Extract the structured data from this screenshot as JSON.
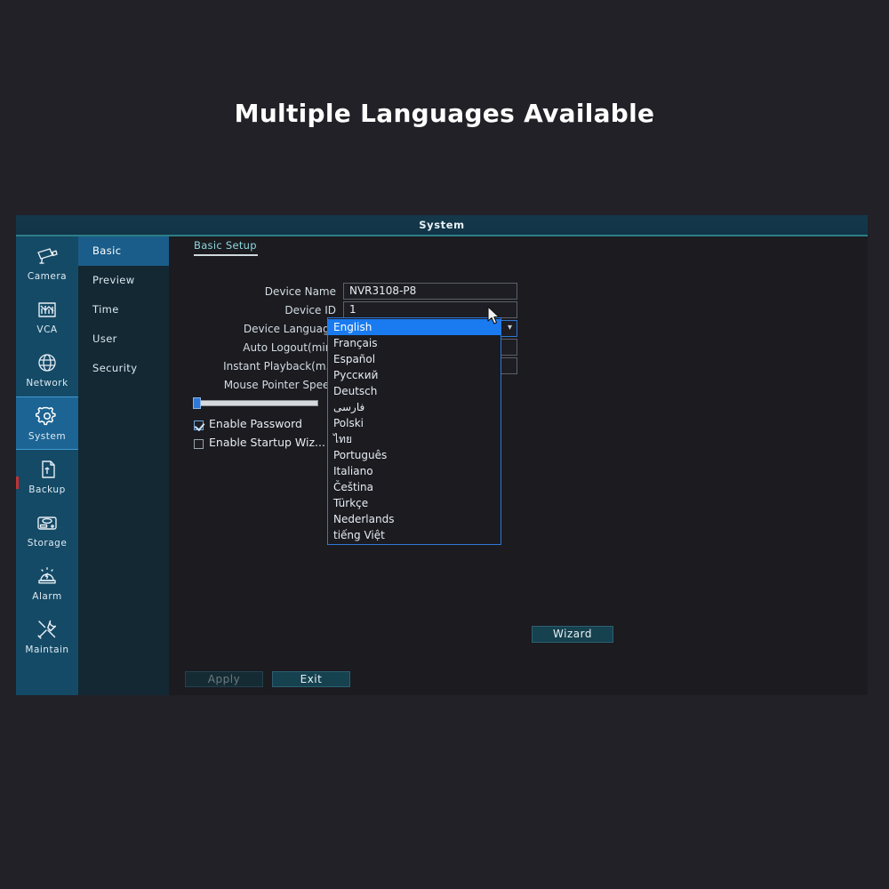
{
  "banner": {
    "title": "Multiple Languages Available"
  },
  "window": {
    "title": "System"
  },
  "icon_sidebar": {
    "items": [
      {
        "label": "Camera",
        "icon": "cctv-camera-icon",
        "active": false
      },
      {
        "label": "VCA",
        "icon": "analytics-chart-icon",
        "active": false
      },
      {
        "label": "Network",
        "icon": "globe-icon",
        "active": false
      },
      {
        "label": "System",
        "icon": "gear-icon",
        "active": true
      },
      {
        "label": "Backup",
        "icon": "usb-drive-icon",
        "active": false
      },
      {
        "label": "Storage",
        "icon": "hard-disk-icon",
        "active": false
      },
      {
        "label": "Alarm",
        "icon": "siren-icon",
        "active": false
      },
      {
        "label": "Maintain",
        "icon": "wrench-screwdriver-icon",
        "active": false
      }
    ]
  },
  "submenu": {
    "items": [
      {
        "label": "Basic",
        "active": true
      },
      {
        "label": "Preview",
        "active": false
      },
      {
        "label": "Time",
        "active": false
      },
      {
        "label": "User",
        "active": false
      },
      {
        "label": "Security",
        "active": false
      }
    ]
  },
  "content": {
    "tab_label": "Basic Setup",
    "fields": {
      "device_name": {
        "label": "Device Name",
        "value": "NVR3108-P8"
      },
      "device_id": {
        "label": "Device ID",
        "value": "1"
      },
      "device_language": {
        "label": "Device Language",
        "value": "English",
        "chevron": "chevron-down-icon"
      },
      "auto_logout": {
        "label": "Auto Logout(min)",
        "value": ""
      },
      "instant_playback": {
        "label": "Instant Playback(m...",
        "value": ""
      },
      "mouse_pointer_speed": {
        "label": "Mouse Pointer Speed",
        "value": "0"
      }
    },
    "checkboxes": [
      {
        "label": "Enable Password",
        "checked": true
      },
      {
        "label": "Enable Startup Wiz...",
        "checked": false
      }
    ],
    "wizard_button": "Wizard",
    "footer": {
      "apply": "Apply",
      "exit": "Exit"
    }
  },
  "language_dropdown": {
    "options": [
      {
        "label": "English",
        "selected": true
      },
      {
        "label": "Français",
        "selected": false
      },
      {
        "label": "Español",
        "selected": false
      },
      {
        "label": "Русский",
        "selected": false
      },
      {
        "label": "Deutsch",
        "selected": false
      },
      {
        "label": "فارسی",
        "selected": false
      },
      {
        "label": "Polski",
        "selected": false
      },
      {
        "label": "ไทย",
        "selected": false
      },
      {
        "label": "Português",
        "selected": false
      },
      {
        "label": "Italiano",
        "selected": false
      },
      {
        "label": "Čeština",
        "selected": false
      },
      {
        "label": "Türkçe",
        "selected": false
      },
      {
        "label": "Nederlands",
        "selected": false
      },
      {
        "label": "tiếng Việt",
        "selected": false
      }
    ]
  },
  "cursor": {
    "icon": "mouse-pointer-icon"
  },
  "colors": {
    "page_background": "#212127",
    "sidebar_blue": "#144a66",
    "sidebar_active": "#1c6493",
    "submenu_background": "#132833",
    "submenu_active": "#1a5d8a",
    "content_background": "#1b1b20",
    "titlebar": "#14384a",
    "accent_teal": "#2d7e86",
    "dropdown_highlight": "#1a7bf0",
    "dropdown_border": "#2f78d6",
    "red_marker": "#c03232"
  }
}
